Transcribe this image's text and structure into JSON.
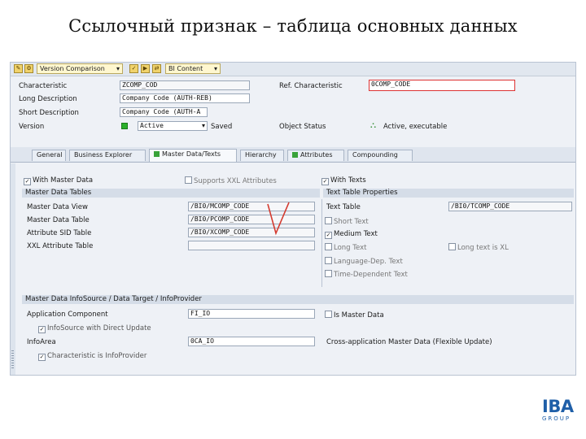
{
  "slide": {
    "title": "Ссылочный признак – таблица основных данных"
  },
  "toolbar": {
    "version_comparison": "Version Comparison",
    "bi_content": "BI Content"
  },
  "header": {
    "characteristic_label": "Characteristic",
    "characteristic_value": "ZCOMP_COD",
    "ref_characteristic_label": "Ref. Characteristic",
    "ref_characteristic_value": "0COMP_CODE",
    "long_description_label": "Long Description",
    "long_description_value": "Company Code (AUTH-REB)",
    "short_description_label": "Short Description",
    "short_description_value": "Company Code (AUTH-A",
    "version_label": "Version",
    "version_value": "Active",
    "version_status": "Saved",
    "object_status_label": "Object Status",
    "object_status_value": "Active, executable"
  },
  "tabs": [
    {
      "label": "General"
    },
    {
      "label": "Business Explorer"
    },
    {
      "label": "Master Data/Texts"
    },
    {
      "label": "Hierarchy"
    },
    {
      "label": "Attributes"
    },
    {
      "label": "Compounding"
    }
  ],
  "options": {
    "with_master_data": "With Master Data",
    "supports_xxl": "Supports XXL Attributes",
    "with_texts": "With Texts"
  },
  "master_data_tables": {
    "head": "Master Data Tables",
    "view_label": "Master Data View",
    "view_value": "/BI0/MCOMP_CODE",
    "table_label": "Master Data Table",
    "table_value": "/BI0/PCOMP_CODE",
    "sid_label": "Attribute SID Table",
    "sid_value": "/BI0/XCOMP_CODE",
    "xxl_label": "XXL Attribute Table",
    "xxl_value": ""
  },
  "text_props": {
    "head": "Text Table Properties",
    "text_table_label": "Text Table",
    "text_table_value": "/BI0/TCOMP_CODE",
    "short_text": "Short Text",
    "medium_text": "Medium Text",
    "long_text": "Long Text",
    "long_text_xl": "Long text is XL",
    "language_dep": "Language-Dep. Text",
    "time_dep": "Time-Dependent Text"
  },
  "infosource": {
    "head": "Master Data InfoSource / Data Target / InfoProvider",
    "app_component_label": "Application Component",
    "app_component_value": "FI_IO",
    "is_master_data": "Is Master Data",
    "infosource_direct": "InfoSource with Direct Update",
    "infoarea_label": "InfoArea",
    "infoarea_value": "0CA_IO",
    "cross_app": "Cross-application Master Data (Flexible Update)",
    "char_is_infoprovider": "Characteristic is InfoProvider"
  },
  "logo": {
    "text": "IBA",
    "sub": "GROUP",
    "color": "#1f5fa8"
  }
}
